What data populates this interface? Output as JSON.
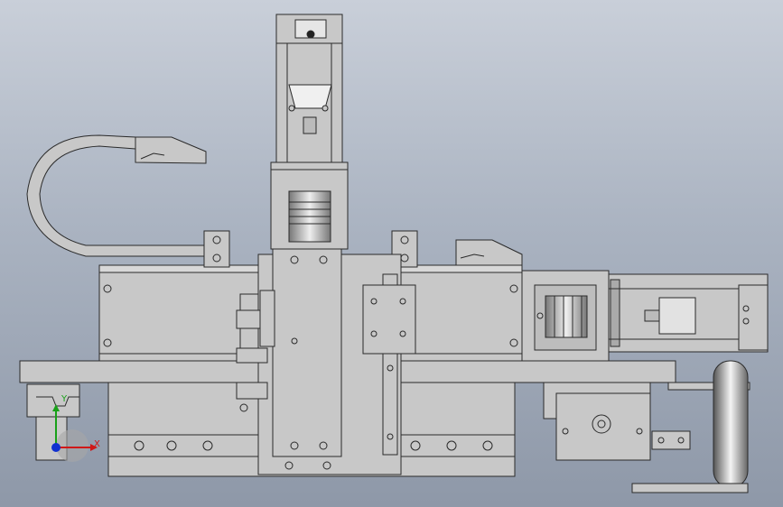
{
  "view": {
    "type": "cad-assembly-front-view",
    "background_top": "#c9cfd9",
    "background_bottom": "#8e98a8",
    "part_fill": "#c8c8c8",
    "part_stroke": "#2a2a2a"
  },
  "triad": {
    "x_label": "X",
    "y_label": "Y",
    "x_color": "#d01818",
    "y_color": "#18a018",
    "z_color": "#1030d0"
  }
}
